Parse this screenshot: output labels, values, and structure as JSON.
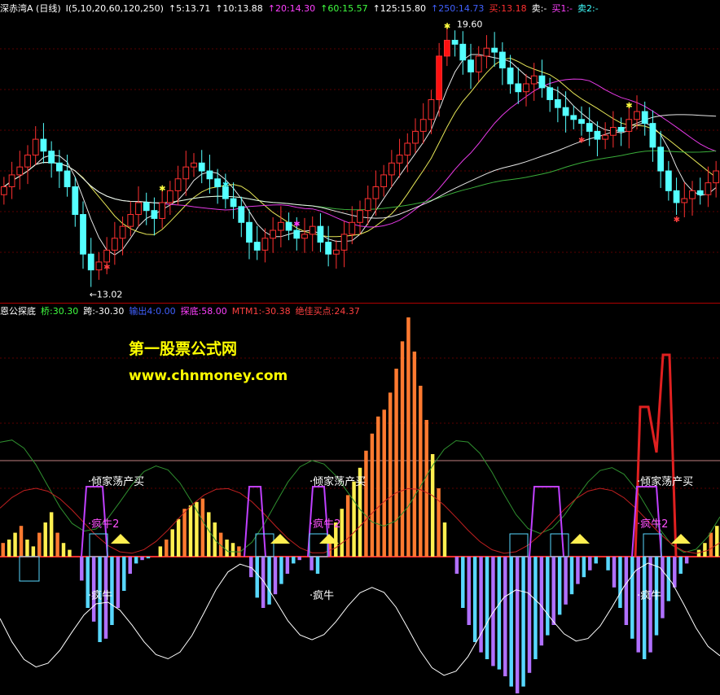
{
  "header_top": {
    "stock": "深赤湾A",
    "period": "(日线)",
    "ma_params": "I(5,10,20,60,120,250)",
    "ma_values": [
      {
        "label": "↑5:13.71",
        "color": "#ffffff"
      },
      {
        "label": "↑10:13.88",
        "color": "#ffffff"
      },
      {
        "label": "↑20:14.30",
        "color": "#ff40ff"
      },
      {
        "label": "↑60:15.57",
        "color": "#40ff40"
      },
      {
        "label": "↑125:15.80",
        "color": "#ffffff"
      },
      {
        "label": "↑250:14.73",
        "color": "#4060ff"
      }
    ],
    "signals": [
      {
        "label": "买:13.18",
        "color": "#ff3030"
      },
      {
        "label": "卖:-",
        "color": "#ffffff"
      },
      {
        "label": "买1:-",
        "color": "#ff40ff"
      },
      {
        "label": "卖2:-",
        "color": "#40ffff"
      }
    ]
  },
  "header_bottom": [
    {
      "label": "恩公探底",
      "color": "#ffffff"
    },
    {
      "label": "桥:30.30",
      "color": "#40ff40"
    },
    {
      "label": "跨:-30.30",
      "color": "#ffffff"
    },
    {
      "label": "输出4:0.00",
      "color": "#4060ff"
    },
    {
      "label": "探底:58.00",
      "color": "#ff40ff"
    },
    {
      "label": "MTM1:-30.38",
      "color": "#ff4040"
    },
    {
      "label": "绝佳买点:24.37",
      "color": "#ff4040"
    }
  ],
  "watermark": {
    "line1": "第一股票公式网",
    "line2": "www.chnmoney.com"
  },
  "chart_data": [
    {
      "type": "candlestick",
      "price_high_label": "19.60",
      "price_low_label": "13.02",
      "closes": [
        15.6,
        15.9,
        16.1,
        16.4,
        16.8,
        16.5,
        16.2,
        16.0,
        15.6,
        14.9,
        13.9,
        13.5,
        13.7,
        14.0,
        14.3,
        14.6,
        14.9,
        15.2,
        15.0,
        14.8,
        15.2,
        15.5,
        15.8,
        16.1,
        16.2,
        16.0,
        15.8,
        15.6,
        15.3,
        15.1,
        14.7,
        14.2,
        14.0,
        14.3,
        14.5,
        14.7,
        14.5,
        14.3,
        14.4,
        14.6,
        14.2,
        13.9,
        14.0,
        14.4,
        14.7,
        15.0,
        15.3,
        15.6,
        15.9,
        16.2,
        16.4,
        16.7,
        17.0,
        17.3,
        17.8,
        18.9,
        19.3,
        19.2,
        18.8,
        18.5,
        18.9,
        19.1,
        19.0,
        18.6,
        18.2,
        18.0,
        18.2,
        18.4,
        18.1,
        17.8,
        17.6,
        17.4,
        17.3,
        17.2,
        17.0,
        16.8,
        16.9,
        17.1,
        17.0,
        17.3,
        17.5,
        17.2,
        16.6,
        16.0,
        15.5,
        15.2,
        15.3,
        15.5,
        15.4,
        15.7,
        16.0
      ]
    },
    {
      "type": "indicator",
      "labels": [
        "倾家荡产买",
        "倾家荡产买",
        "倾家荡产买",
        "疯牛2",
        "疯牛2",
        "疯牛2",
        "疯牛",
        "疯牛",
        "疯牛"
      ],
      "bars": [
        8,
        10,
        14,
        18,
        10,
        6,
        14,
        20,
        26,
        14,
        8,
        4,
        0,
        -14,
        -30,
        -38,
        -50,
        -48,
        -40,
        -30,
        -20,
        -10,
        -4,
        -2,
        -1,
        0,
        6,
        10,
        16,
        22,
        28,
        30,
        32,
        34,
        26,
        20,
        14,
        10,
        8,
        6,
        0,
        -12,
        -24,
        -30,
        -28,
        -22,
        -16,
        -10,
        -4,
        -2,
        0,
        -8,
        -10,
        0,
        10,
        20,
        28,
        36,
        44,
        52,
        62,
        72,
        82,
        86,
        96,
        110,
        126,
        140,
        120,
        100,
        80,
        60,
        40,
        20,
        0,
        -10,
        -30,
        -40,
        -50,
        -56,
        -60,
        -64,
        -66,
        -70,
        -76,
        -80,
        -76,
        -68,
        -60,
        -52,
        -46,
        -40,
        -34,
        -28,
        -22,
        -16,
        -12,
        -8,
        -4,
        0,
        -8,
        -18,
        -30,
        -40,
        -48,
        -56,
        -60,
        -56,
        -46,
        -36,
        -26,
        -18,
        -10,
        -4,
        0,
        4,
        8,
        14,
        18
      ]
    }
  ]
}
